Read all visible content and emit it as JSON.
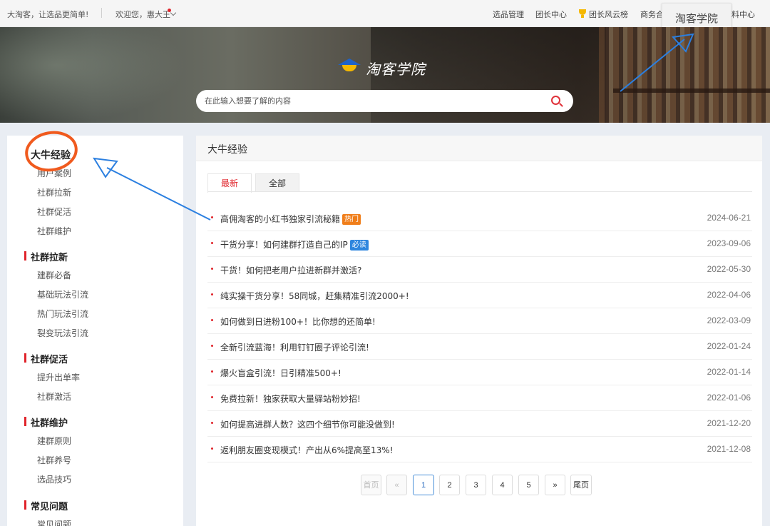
{
  "topbar": {
    "slogan": "大淘客，让选品更简单!",
    "welcome": "欢迎您，惠大王",
    "nav": [
      "选品管理",
      "团长中心",
      "团长风云榜",
      "商务合",
      "料中心"
    ],
    "popup_label": "淘客学院"
  },
  "banner": {
    "logo_text": "淘客学院",
    "search_placeholder": "在此输入想要了解的内容"
  },
  "sidebar": {
    "categories": [
      {
        "title": "大牛经验",
        "items": [
          "用户案例",
          "社群拉新",
          "社群促活",
          "社群维护"
        ]
      },
      {
        "title": "社群拉新",
        "items": [
          "建群必备",
          "基础玩法引流",
          "热门玩法引流",
          "裂变玩法引流"
        ]
      },
      {
        "title": "社群促活",
        "items": [
          "提升出单率",
          "社群激活"
        ]
      },
      {
        "title": "社群维护",
        "items": [
          "建群原则",
          "社群养号",
          "选品技巧"
        ]
      },
      {
        "title": "常见问题",
        "items": [
          "常见问题"
        ]
      }
    ]
  },
  "main": {
    "title": "大牛经验",
    "tabs": [
      "最新",
      "全部"
    ],
    "articles": [
      {
        "title": "高佣淘客的小红书独家引流秘籍",
        "badge": "热门",
        "date": "2024-06-21"
      },
      {
        "title": "干货分享！如何建群打造自己的IP",
        "badge": "必读",
        "date": "2023-09-06"
      },
      {
        "title": "干货！如何把老用户拉进新群并激活?",
        "badge": "",
        "date": "2022-05-30"
      },
      {
        "title": "纯实操干货分享！58同城，赶集精准引流2000+!",
        "badge": "",
        "date": "2022-04-06"
      },
      {
        "title": "如何做到日进粉100+！比你想的还简单!",
        "badge": "",
        "date": "2022-03-09"
      },
      {
        "title": "全新引流蓝海！利用钉钉圈子评论引流!",
        "badge": "",
        "date": "2022-01-24"
      },
      {
        "title": "爆火盲盒引流！日引精准500+!",
        "badge": "",
        "date": "2022-01-14"
      },
      {
        "title": "免费拉新！独家获取大量驿站粉妙招!",
        "badge": "",
        "date": "2022-01-06"
      },
      {
        "title": "如何提高进群人数？这四个细节你可能没做到!",
        "badge": "",
        "date": "2021-12-20"
      },
      {
        "title": "返利朋友圈变现模式！产出从6%提高至13%!",
        "badge": "",
        "date": "2021-12-08"
      }
    ],
    "pagination": {
      "first": "首页",
      "prev": "«",
      "pages": [
        "1",
        "2",
        "3",
        "4",
        "5"
      ],
      "current": "1",
      "next": "»",
      "last": "尾页"
    }
  },
  "colors": {
    "accent": "#e0242b",
    "hot_badge": "#f07e1a",
    "must_badge": "#2f86de",
    "annotation": "#2b7fe0",
    "circle": "#f05a1e"
  },
  "icons": [
    "graduation-cap-icon",
    "search-icon",
    "trophy-icon",
    "chevron-down-icon"
  ]
}
